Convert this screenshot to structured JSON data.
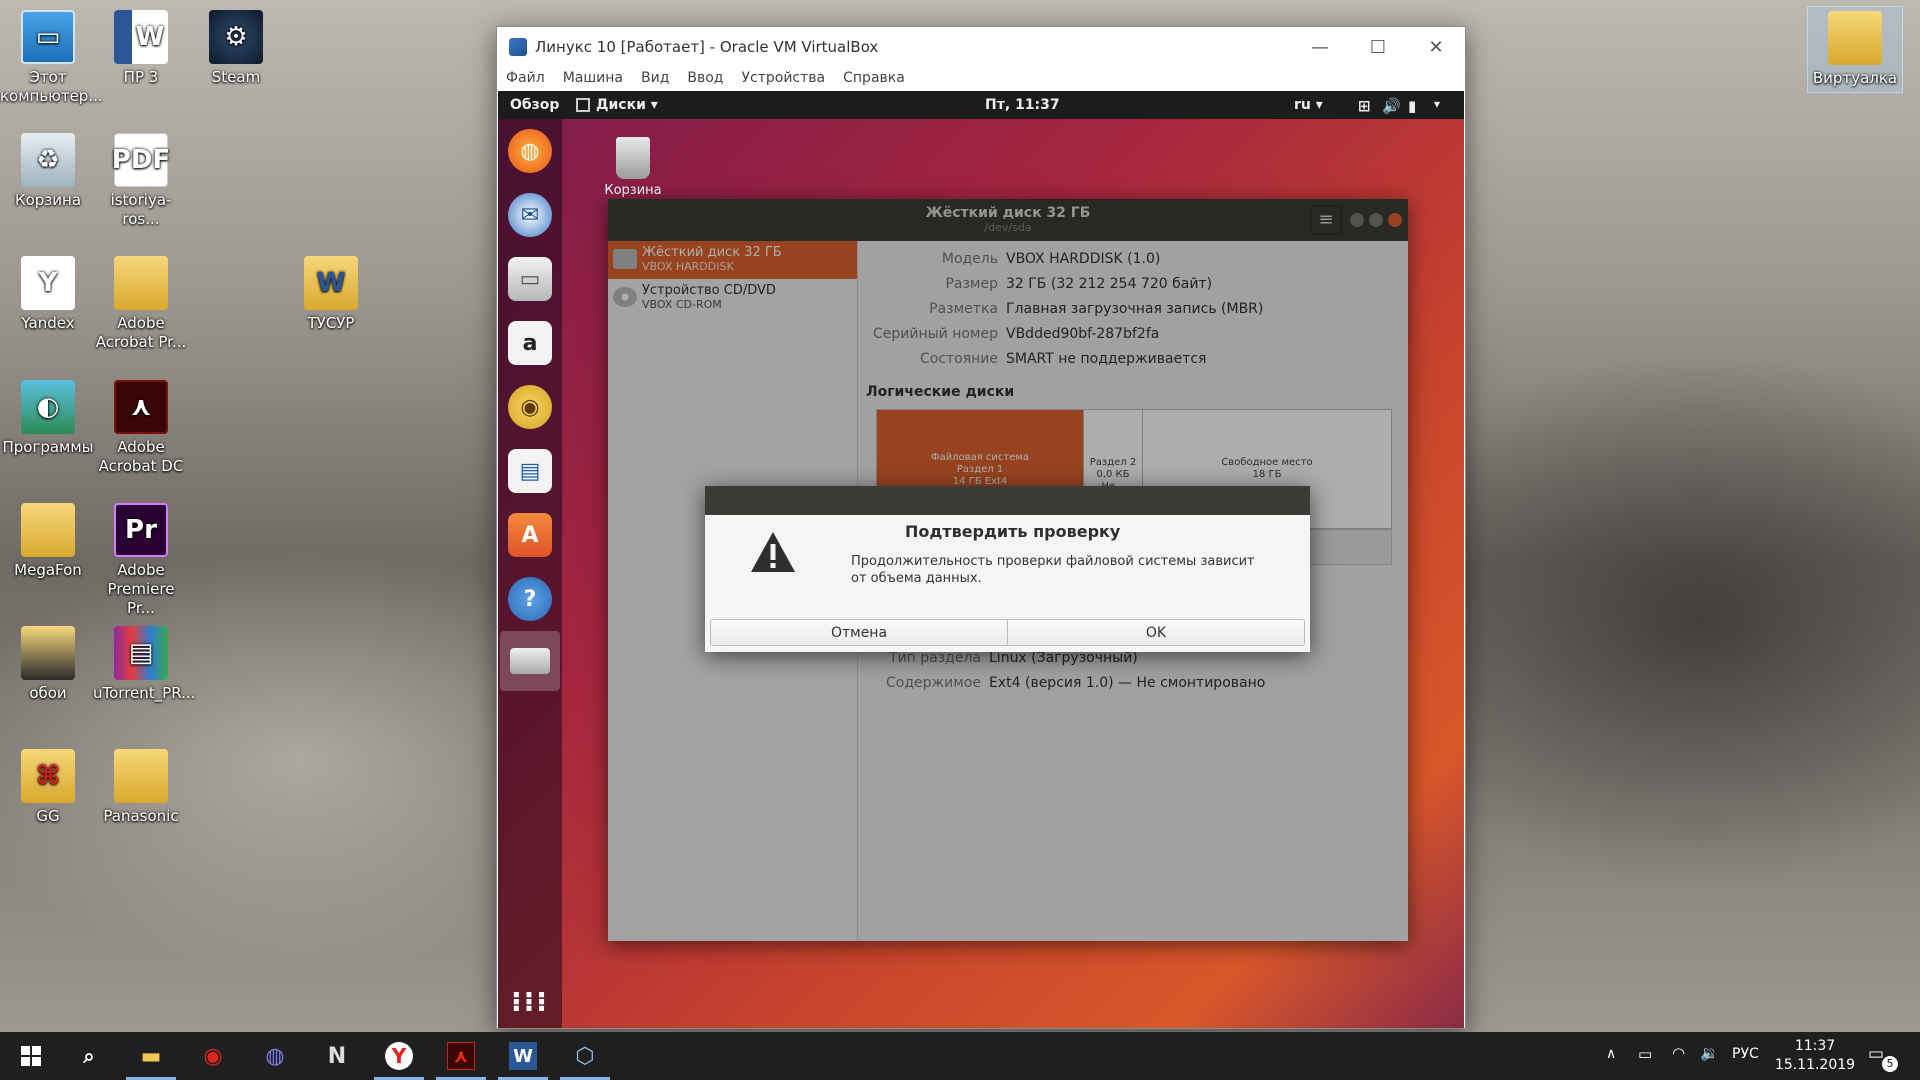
{
  "desktop": {
    "icons": [
      {
        "label": "Этот компьютер...",
        "icon": "computer-icon"
      },
      {
        "label": "ПР 3",
        "icon": "word-doc-icon"
      },
      {
        "label": "Steam",
        "icon": "steam-icon"
      },
      {
        "label": "Корзина",
        "icon": "recycle-bin-icon"
      },
      {
        "label": "istoriya-ros...",
        "icon": "pdf-icon"
      },
      {
        "label": "Yandex",
        "icon": "yandex-browser-icon"
      },
      {
        "label": "Adobe Acrobat Pr...",
        "icon": "folder-icon"
      },
      {
        "label": "ТУСУР",
        "icon": "word-folder-icon"
      },
      {
        "label": "Программы",
        "icon": "programs-icon"
      },
      {
        "label": "Adobe Acrobat DC",
        "icon": "acrobat-icon"
      },
      {
        "label": "MegaFon",
        "icon": "folder-icon"
      },
      {
        "label": "Adobe Premiere Pr...",
        "icon": "premiere-icon"
      },
      {
        "label": "обои",
        "icon": "folder-icon"
      },
      {
        "label": "uTorrent_PR...",
        "icon": "winrar-icon"
      },
      {
        "label": "GG",
        "icon": "folder-icon"
      },
      {
        "label": "Panasonic",
        "icon": "folder-icon"
      },
      {
        "label": "Виртуалка",
        "icon": "folder-icon"
      }
    ]
  },
  "vbox": {
    "title": "Линукс 10 [Работает] - Oracle VM VirtualBox",
    "menu": [
      "Файл",
      "Машина",
      "Вид",
      "Ввод",
      "Устройства",
      "Справка"
    ],
    "min": "—",
    "max": "☐",
    "close": "✕"
  },
  "gnome": {
    "activities": "Обзор",
    "app_menu": "Диски ▾",
    "clock": "Пт, 11:37",
    "lang": "ru ▾",
    "trash_label": "Корзина"
  },
  "disks": {
    "title": "Жёсткий диск 32 ГБ",
    "subtitle": "/dev/sda",
    "menu_glyph": "≡",
    "devices": [
      {
        "name": "Жёсткий диск 32 ГБ",
        "sub": "VBOX HARDDISK"
      },
      {
        "name": "Устройство CD/DVD",
        "sub": "VBOX CD-ROM"
      }
    ],
    "props": [
      {
        "k": "Модель",
        "v": "VBOX HARDDISK (1.0)"
      },
      {
        "k": "Размер",
        "v": "32 ГБ (32 212 254 720 байт)"
      },
      {
        "k": "Разметка",
        "v": "Главная загрузочная запись (MBR)"
      },
      {
        "k": "Серийный номер",
        "v": "VBdded90bf-287bf2fa"
      },
      {
        "k": "Состояние",
        "v": "SMART не поддерживается"
      }
    ],
    "volumes_title": "Логические диски",
    "segments": [
      {
        "l1": "Файловая система",
        "l2": "Раздел 1",
        "l3": "14 ГБ Ext4"
      },
      {
        "l1": "Раздел 2",
        "l2": "0,0 КБ Не...",
        "l3": ""
      },
      {
        "l1": "Свободное место",
        "l2": "18 ГБ",
        "l3": ""
      }
    ],
    "lower_props": [
      {
        "k": "Тип раздела",
        "v": "Linux (Загрузочный)"
      },
      {
        "k": "Содержимое",
        "v": "Ext4 (версия 1.0) — Не смонтировано"
      }
    ]
  },
  "dialog": {
    "title": "Подтвердить проверку",
    "message1": "Продолжительность проверки файловой системы зависит",
    "message2": "от объема данных.",
    "cancel": "Отмена",
    "ok": "OK"
  },
  "taskbar": {
    "lang": "РУС",
    "time": "11:37",
    "date": "15.11.2019",
    "notifications": "5"
  },
  "colors": {
    "accent": "#e0642e",
    "taskbar": "#1f1f1f",
    "gnome_bar": "#1c1c1c",
    "headerbar": "#3c3b37"
  }
}
